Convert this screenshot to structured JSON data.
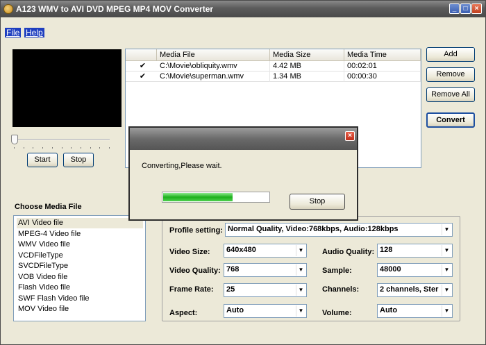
{
  "window": {
    "title": "A123 WMV to AVI DVD MPEG MP4 MOV Converter",
    "minimize": "_",
    "maximize": "□",
    "close": "×"
  },
  "menu": [
    "File",
    "Help"
  ],
  "player": {
    "start_label": "Start",
    "stop_label": "Stop",
    "position_fraction": 0.0
  },
  "file_list": {
    "columns": [
      "",
      "Media File",
      "Media Size",
      "Media Time"
    ],
    "rows": [
      {
        "checked": "✔",
        "file": "C:\\Movie\\obliquity.wmv",
        "size": "4.42 MB",
        "time": "00:02:01"
      },
      {
        "checked": "✔",
        "file": "C:\\Movie\\superman.wmv",
        "size": "1.34 MB",
        "time": "00:00:30"
      }
    ]
  },
  "actions": {
    "add": "Add",
    "remove": "Remove",
    "remove_all": "Remove All",
    "convert": "Convert"
  },
  "media_types": {
    "title": "Choose Media File",
    "items": [
      "AVI Video file",
      "MPEG-4 Video file",
      "WMV Video file",
      "VCDFileType",
      "SVCDFileType",
      "VOB Video file",
      "Flash Video file",
      "SWF Flash Video file",
      "MOV Video file"
    ],
    "selected_index": 0
  },
  "settings": {
    "profile_label": "Profile setting:",
    "profile_value": "Normal Quality, Video:768kbps, Audio:128kbps",
    "video_size_label": "Video Size:",
    "video_size_value": "640x480",
    "video_quality_label": "Video Quality:",
    "video_quality_value": "768",
    "frame_rate_label": "Frame Rate:",
    "frame_rate_value": "25",
    "aspect_label": "Aspect:",
    "aspect_value": "Auto",
    "audio_quality_label": "Audio Quality:",
    "audio_quality_value": "128",
    "sample_label": "Sample:",
    "sample_value": "48000",
    "channels_label": "Channels:",
    "channels_value": "2 channels, Ster",
    "volume_label": "Volume:",
    "volume_value": "Auto"
  },
  "dialog": {
    "close": "×",
    "message": "Converting,Please wait.",
    "progress_fraction": 0.66,
    "stop_label": "Stop"
  },
  "colors": {
    "progress": "#1db01d",
    "menu_highlight": "#1f3fbf",
    "close_button": "#c02e1a"
  }
}
